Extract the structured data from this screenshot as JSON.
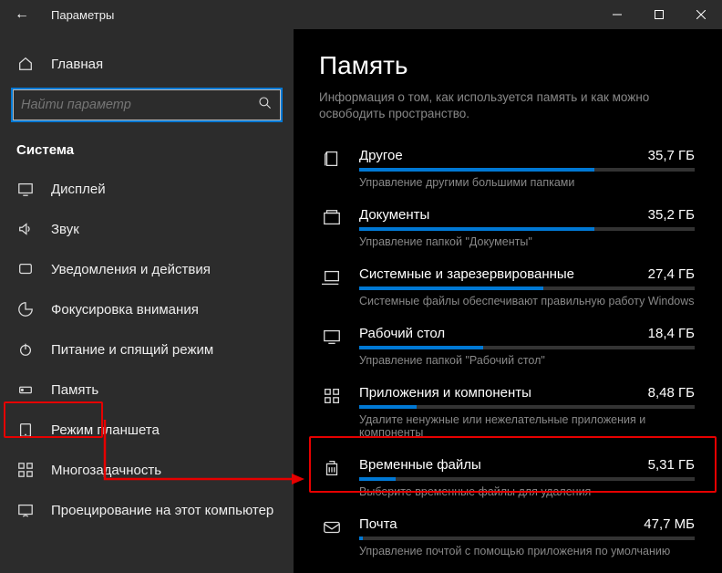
{
  "titlebar": {
    "title": "Параметры"
  },
  "sidebar": {
    "home": "Главная",
    "search_placeholder": "Найти параметр",
    "section": "Система",
    "items": [
      {
        "label": "Дисплей"
      },
      {
        "label": "Звук"
      },
      {
        "label": "Уведомления и действия"
      },
      {
        "label": "Фокусировка внимания"
      },
      {
        "label": "Питание и спящий режим"
      },
      {
        "label": "Память"
      },
      {
        "label": "Режим планшета"
      },
      {
        "label": "Многозадачность"
      },
      {
        "label": "Проецирование на этот компьютер"
      }
    ]
  },
  "content": {
    "title": "Память",
    "subtitle": "Информация о том, как используется память и как можно освободить пространство.",
    "items": [
      {
        "name": "Другое",
        "size": "35,7 ГБ",
        "desc": "Управление другими большими папками",
        "pct": 70
      },
      {
        "name": "Документы",
        "size": "35,2 ГБ",
        "desc": "Управление папкой \"Документы\"",
        "pct": 70
      },
      {
        "name": "Системные и зарезервированные",
        "size": "27,4 ГБ",
        "desc": "Системные файлы обеспечивают правильную работу Windows",
        "pct": 55
      },
      {
        "name": "Рабочий стол",
        "size": "18,4 ГБ",
        "desc": "Управление папкой \"Рабочий стол\"",
        "pct": 37
      },
      {
        "name": "Приложения и компоненты",
        "size": "8,48 ГБ",
        "desc": "Удалите ненужные или нежелательные приложения и компоненты",
        "pct": 17
      },
      {
        "name": "Временные файлы",
        "size": "5,31 ГБ",
        "desc": "Выберите временные файлы для удаления",
        "pct": 11
      },
      {
        "name": "Почта",
        "size": "47,7 МБ",
        "desc": "Управление почтой с помощью приложения по умолчанию",
        "pct": 1
      }
    ]
  }
}
